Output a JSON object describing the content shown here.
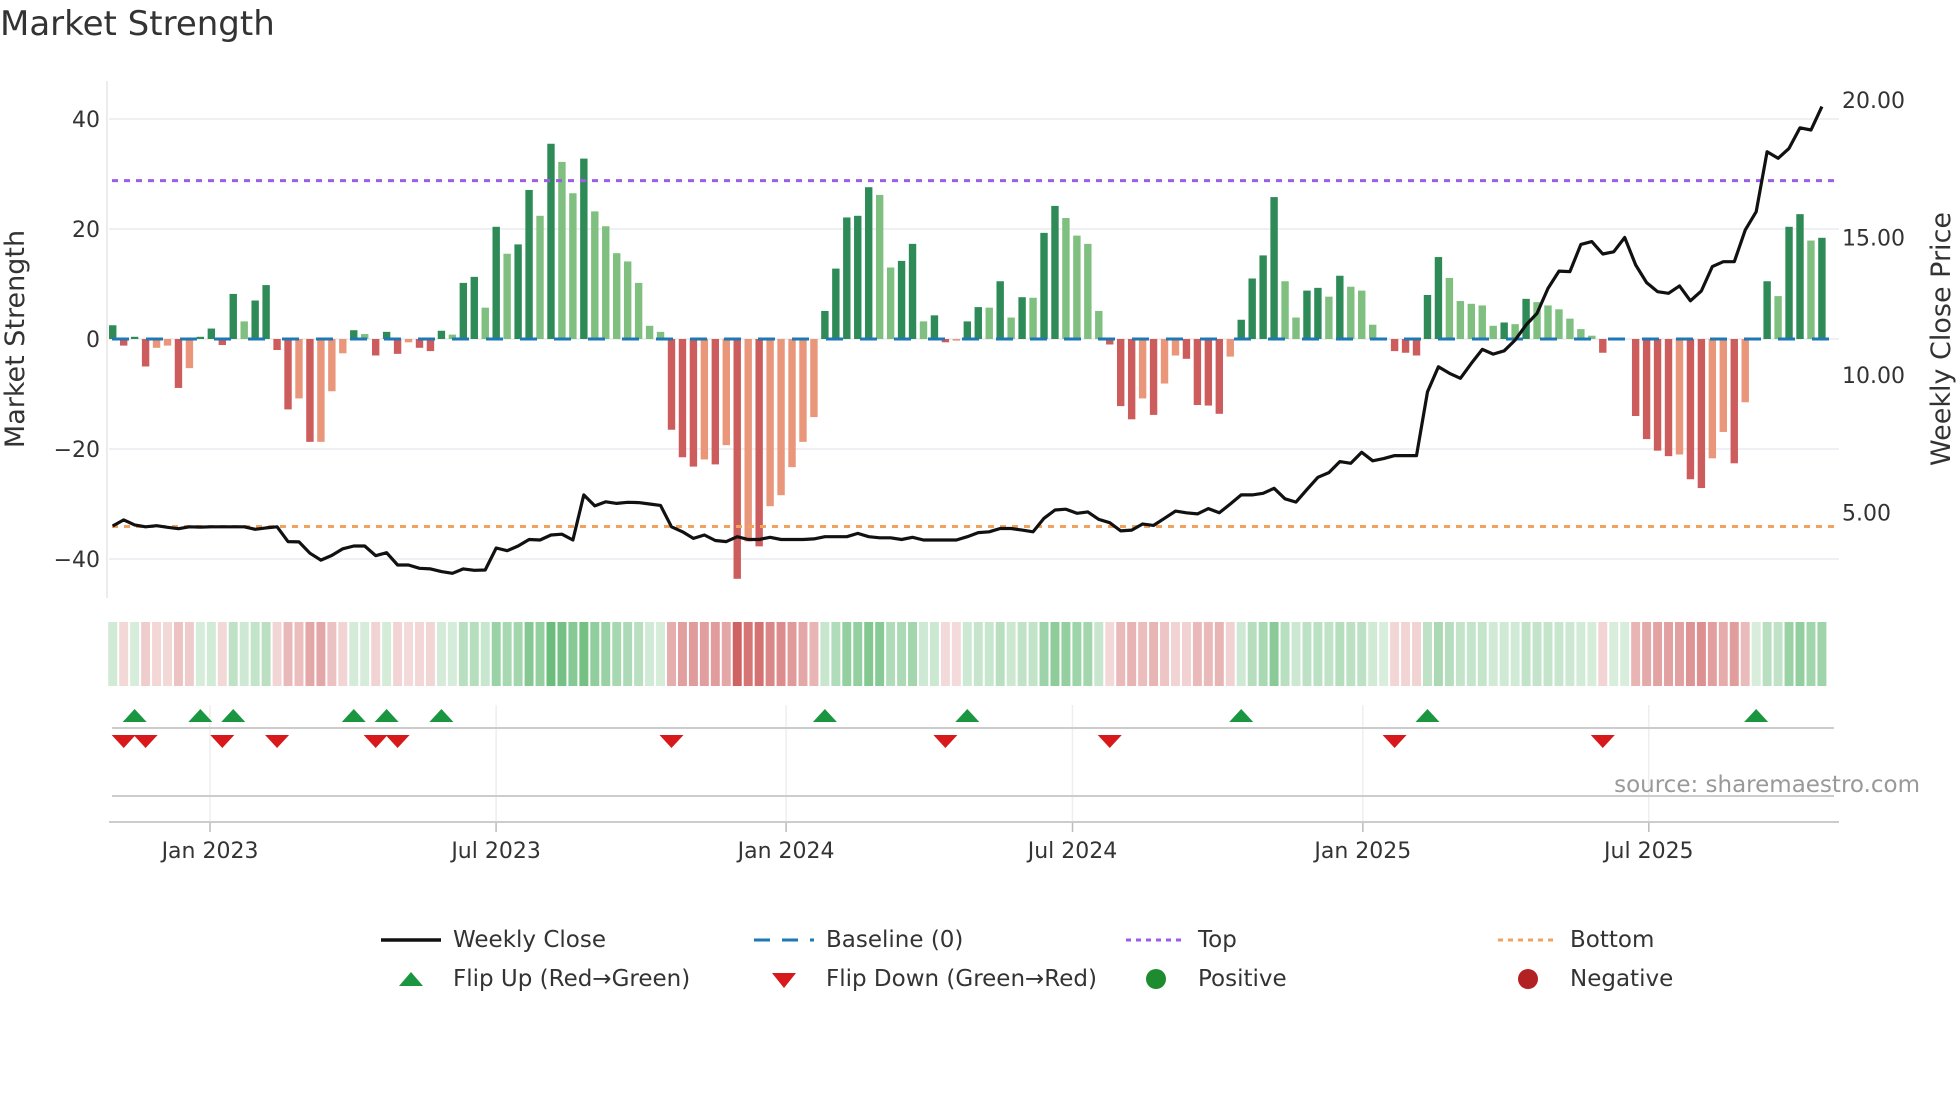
{
  "title": "Market Strength",
  "source": "source: sharemaestro.com",
  "colors": {
    "dark_green": "#2e8b57",
    "light_green": "#7fbf7f",
    "red": "#cd5c5c",
    "salmon": "#e9967a",
    "baseline": "#1f77b4",
    "top": "#9b5de5",
    "bottom": "#f0a35e",
    "price": "#111111",
    "flip_up": "#1a9641",
    "flip_down": "#d7191c",
    "positive": "#1e8c2e",
    "negative": "#b22222"
  },
  "legend": [
    {
      "label": "Weekly Close",
      "icon": "solid-line"
    },
    {
      "label": "Baseline (0)",
      "icon": "dashed-line"
    },
    {
      "label": "Top",
      "icon": "dotted-line"
    },
    {
      "label": "Bottom",
      "icon": "dotted-line"
    },
    {
      "label": "Flip Up (Red→Green)",
      "icon": "triangle-up"
    },
    {
      "label": "Flip Down (Green→Red)",
      "icon": "triangle-down"
    },
    {
      "label": "Positive",
      "icon": "circle"
    },
    {
      "label": "Negative",
      "icon": "circle"
    }
  ],
  "chart_data": {
    "type": "bar",
    "title": "Market Strength",
    "ylabel": "Market Strength",
    "y2label": "Weekly Close Price",
    "ylim": [
      -47,
      51
    ],
    "y2lim": [
      2.0,
      22.5
    ],
    "x_index_range": [
      -0.34,
      157.56
    ],
    "yticks": [
      {
        "label": "40",
        "value": 40
      },
      {
        "label": "20",
        "value": 20
      },
      {
        "label": "0",
        "value": 0
      },
      {
        "label": "−20",
        "value": -20
      },
      {
        "label": "−40",
        "value": -40
      }
    ],
    "y2ticks": [
      {
        "label": "20.00",
        "value": 20
      },
      {
        "label": "15.00",
        "value": 15
      },
      {
        "label": "10.00",
        "value": 10
      },
      {
        "label": "5.00",
        "value": 5
      }
    ],
    "xticks": [
      {
        "label": "Jan 2023",
        "index": 8.88
      },
      {
        "label": "Jul 2023",
        "index": 34.99
      },
      {
        "label": "Jan 2024",
        "index": 61.46
      },
      {
        "label": "Jul 2024",
        "index": 87.6
      },
      {
        "label": "Jan 2025",
        "index": 114.1
      },
      {
        "label": "Jul 2025",
        "index": 140.2
      }
    ],
    "top_level": 28.8,
    "bottom_level": -34.1,
    "baseline": 0,
    "strength": [
      2.5,
      -1.2,
      0.4,
      -5,
      -1.6,
      -1.2,
      -8.9,
      -5.3,
      0.4,
      1.9,
      -1.1,
      8.2,
      3.2,
      7,
      9.8,
      -2,
      -12.8,
      -10.8,
      -18.7,
      -18.7,
      -9.5,
      -2.6,
      1.6,
      0.9,
      -3,
      1.3,
      -2.7,
      -0.6,
      -1.6,
      -2.2,
      1.5,
      0.8,
      10.2,
      11.3,
      5.7,
      20.4,
      15.5,
      17.2,
      27.1,
      22.4,
      35.5,
      32.2,
      26.5,
      32.8,
      23.2,
      20.5,
      15.6,
      14.1,
      10.2,
      2.4,
      1.3,
      -16.5,
      -21.5,
      -23.2,
      -21.9,
      -22.8,
      -19.3,
      -43.6,
      -36.8,
      -37.7,
      -30.4,
      -28.4,
      -23.3,
      -18.7,
      -14.2,
      5.1,
      12.8,
      22.1,
      22.4,
      27.6,
      26.2,
      13,
      14.2,
      17.3,
      3.2,
      4.3,
      -0.6,
      -0.3,
      3.2,
      5.8,
      5.7,
      10.5,
      3.9,
      7.6,
      7.5,
      19.3,
      24.2,
      22,
      18.8,
      17.3,
      5.1,
      -1,
      -12.2,
      -14.6,
      -10.8,
      -13.8,
      -8.1,
      -3,
      -3.6,
      -12,
      -12.1,
      -13.6,
      -3.2,
      3.5,
      11,
      15.2,
      25.8,
      10.5,
      3.9,
      8.8,
      9.3,
      7.7,
      11.5,
      9.5,
      8.8,
      2.6,
      0,
      -2.2,
      -2.5,
      -3,
      8,
      14.9,
      11.1,
      6.9,
      6.4,
      6.1,
      2.4,
      3,
      2.7,
      7.3,
      6.7,
      6.1,
      5.4,
      3.7,
      1.8,
      0.6,
      -2.5,
      0,
      0,
      -14,
      -18.2,
      -20.3,
      -21.3,
      -21,
      -25.5,
      -27.1,
      -21.7,
      -16.9,
      -22.6,
      -11.5,
      0,
      10.5,
      7.8,
      20.4,
      22.7,
      17.9,
      18.4
    ],
    "shade": "DRDRSSRSDDRDLDDRRSRSSSDLRDRSRRDLDDLDLDDLDLLDLLLLLLLRRRSRSRSRSSSSSDDDDDLLDDLDRSDDLDLDLDDLLLLRRRSRSSRRRRSDDDDLLDDLDLLLLRRRDDLLLLLDLDLLLLLLRRRRRRRSRRSSRSSDLDDLD",
    "weekly_close": [
      4.51,
      4.73,
      4.55,
      4.48,
      4.52,
      4.46,
      4.41,
      4.48,
      4.47,
      4.48,
      4.48,
      4.48,
      4.48,
      4.39,
      4.44,
      4.48,
      3.94,
      3.93,
      3.52,
      3.27,
      3.44,
      3.68,
      3.78,
      3.78,
      3.43,
      3.54,
      3.09,
      3.09,
      2.97,
      2.95,
      2.85,
      2.79,
      2.95,
      2.9,
      2.91,
      3.71,
      3.61,
      3.78,
      4.02,
      4.0,
      4.18,
      4.21,
      4.0,
      5.64,
      5.24,
      5.39,
      5.33,
      5.37,
      5.36,
      5.31,
      5.26,
      4.48,
      4.3,
      4.06,
      4.18,
      3.98,
      3.94,
      4.12,
      4.02,
      4.02,
      4.1,
      4.02,
      4.02,
      4.02,
      4.04,
      4.12,
      4.12,
      4.12,
      4.24,
      4.12,
      4.08,
      4.08,
      4.02,
      4.1,
      4.0,
      4.0,
      4.0,
      4.0,
      4.12,
      4.27,
      4.3,
      4.42,
      4.42,
      4.36,
      4.3,
      4.79,
      5.09,
      5.12,
      4.97,
      5.02,
      4.75,
      4.63,
      4.33,
      4.36,
      4.58,
      4.53,
      4.79,
      5.05,
      4.99,
      4.95,
      5.14,
      4.99,
      5.31,
      5.64,
      5.64,
      5.7,
      5.88,
      5.5,
      5.38,
      5.84,
      6.28,
      6.45,
      6.85,
      6.79,
      7.19,
      6.88,
      6.96,
      7.07,
      7.07,
      7.07,
      9.39,
      10.3,
      10.06,
      9.88,
      10.42,
      10.93,
      10.76,
      10.88,
      11.27,
      11.82,
      12.24,
      13.15,
      13.78,
      13.76,
      14.75,
      14.85,
      14.4,
      14.48,
      15.0,
      14.0,
      13.36,
      13.03,
      12.97,
      13.24,
      12.7,
      13.06,
      13.94,
      14.12,
      14.12,
      15.27,
      15.94,
      18.12,
      17.88,
      18.24,
      18.99,
      18.91,
      19.76
    ],
    "flip_up": [
      2,
      8,
      11,
      22,
      25,
      30,
      65,
      78,
      103,
      120,
      150
    ],
    "flip_down": [
      1,
      3,
      10,
      15,
      24,
      26,
      51,
      76,
      91,
      117,
      136
    ],
    "grid": true,
    "legend_position": "bottom"
  }
}
